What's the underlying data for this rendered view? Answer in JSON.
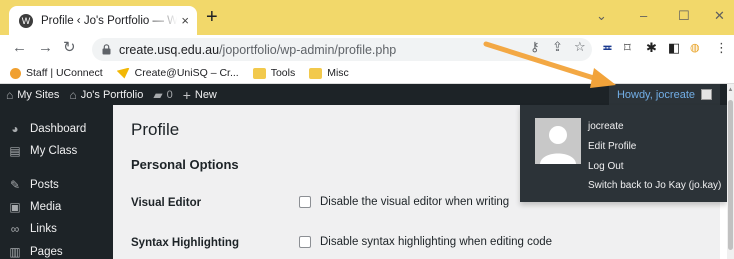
{
  "browser": {
    "tab_title": "Profile ‹ Jo's Portfolio — WordPress",
    "tab_close": "×",
    "new_tab": "+",
    "controls": {
      "collapse": "⌄",
      "minimize": "–",
      "maximize": "☐",
      "close": "✕"
    },
    "url_host": "create.usq.edu.au",
    "url_path": "/joportfolio/wp-admin/profile.php",
    "bookmarks": [
      {
        "label": "Staff | UConnect",
        "icon": "staff-icon",
        "color": "#f0a030"
      },
      {
        "label": "Create@UniSQ – Cr...",
        "icon": "create-icon",
        "color": "#f2b705"
      },
      {
        "label": "Tools",
        "icon": "folder-icon",
        "color": "#f2c94c"
      },
      {
        "label": "Misc",
        "icon": "folder-icon",
        "color": "#f2c94c"
      }
    ]
  },
  "adminbar": {
    "items": [
      {
        "label": "My Sites",
        "icon": "my-sites-icon"
      },
      {
        "label": "Jo's Portfolio",
        "icon": "home-icon"
      },
      {
        "label": "0",
        "icon": "comments-icon"
      },
      {
        "label": "New",
        "icon": "plus-icon"
      }
    ],
    "howdy": "Howdy, jocreate"
  },
  "sidebar": {
    "items": [
      {
        "label": "Dashboard",
        "icon": "dashboard-icon"
      },
      {
        "label": "My Class",
        "icon": "my-class-icon"
      },
      {
        "label": "Posts",
        "icon": "pin-icon"
      },
      {
        "label": "Media",
        "icon": "media-icon"
      },
      {
        "label": "Links",
        "icon": "links-icon"
      },
      {
        "label": "Pages",
        "icon": "pages-icon"
      }
    ]
  },
  "main": {
    "title": "Profile",
    "section": "Personal Options",
    "rows": [
      {
        "label": "Visual Editor",
        "option": "Disable the visual editor when writing",
        "checked": false
      },
      {
        "label": "Syntax Highlighting",
        "option": "Disable syntax highlighting when editing code",
        "checked": false
      }
    ]
  },
  "dropdown": {
    "username": "jocreate",
    "edit_profile": "Edit Profile",
    "log_out": "Log Out",
    "switch_back": "Switch back to Jo Kay (jo.kay)"
  },
  "colors": {
    "tab_strip": "#f2d86a",
    "admin_bar": "#1d2327",
    "howdy_link": "#72aee6",
    "arrow": "#f2a33a"
  }
}
